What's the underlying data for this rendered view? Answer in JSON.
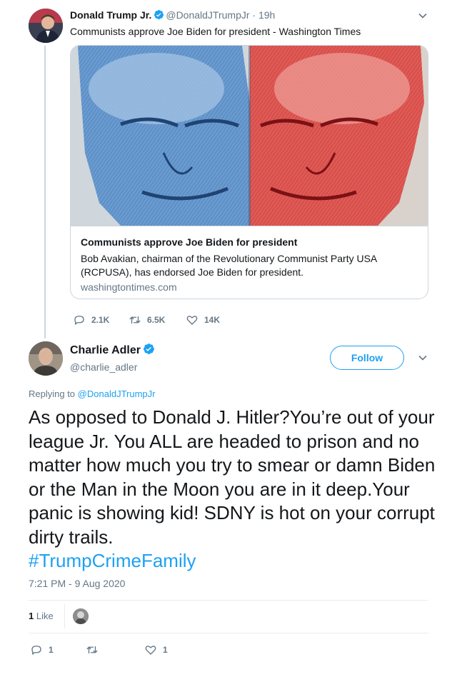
{
  "parent_tweet": {
    "author_name": "Donald Trump Jr.",
    "handle": "@DonaldJTrumpJr",
    "time": "19h",
    "separator": "·",
    "text": "Communists approve Joe Biden for president - Washington Times",
    "card": {
      "title": "Communists approve Joe Biden for president",
      "description": "Bob Avakian, chairman of the Revolutionary Communist Party USA (RCPUSA), has endorsed Joe Biden for president.",
      "domain": "washingtontimes.com"
    },
    "actions": {
      "replies": "2.1K",
      "retweets": "6.5K",
      "likes": "14K"
    }
  },
  "reply_tweet": {
    "author_name": "Charlie Adler",
    "handle": "@charlie_adler",
    "follow_label": "Follow",
    "replying_prefix": "Replying to",
    "replying_to": "@DonaldJTrumpJr",
    "text": "As opposed to Donald J. Hitler?You’re out of your league Jr. You ALL are headed to prison and no matter how much you try to smear or damn Biden or the Man  in the Moon you are in it deep.Your panic is showing kid! SDNY is hot on your corrupt dirty trails.",
    "hashtag": "#TrumpCrimeFamily",
    "timestamp": "7:21 PM - 9 Aug 2020",
    "likes_count": "1",
    "likes_label": "Like",
    "actions": {
      "replies": "1",
      "retweets": "",
      "likes": "1"
    }
  },
  "icons": {
    "verified": "verified-badge-icon",
    "chevron": "chevron-down-icon",
    "reply": "reply-icon",
    "retweet": "retweet-icon",
    "like": "heart-icon"
  },
  "colors": {
    "accent": "#1da1f2",
    "muted": "#657786",
    "border": "#ccd6dd",
    "text": "#14171a",
    "card_image_blue": "#4f86c6",
    "card_image_red": "#d0393a"
  }
}
